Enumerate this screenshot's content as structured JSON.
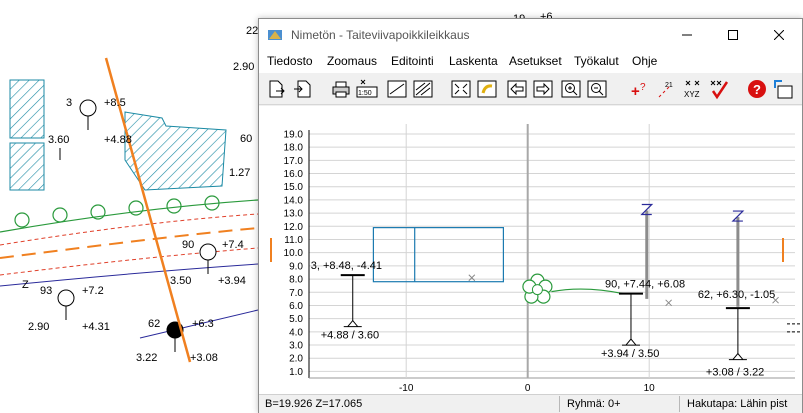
{
  "window": {
    "title": "Nimetön - Taiteviivapoikkileikkaus"
  },
  "menu": [
    "Tiedosto",
    "Zoomaus",
    "Editointi",
    "Laskenta",
    "Asetukset",
    "Työkalut",
    "Ohje"
  ],
  "toolbar": {
    "icons": [
      "new-file-icon",
      "open-file-icon",
      "print-icon",
      "scale-icon",
      "print-preview-icon",
      "hatch-icon",
      "zoom-extents-icon",
      "pan-icon",
      "previous-icon",
      "next-icon",
      "zoom-in-icon",
      "zoom-out-icon",
      "add-point-icon",
      "renumber-icon",
      "xyz-icon",
      "check-icon",
      "help-icon",
      "export-icon"
    ],
    "scale_label": "1:50",
    "number_label": "21"
  },
  "statusbar": {
    "coords": "B=19.926  Z=17.065",
    "group": "Ryhmä: 0+",
    "search": "Hakutapa: Lähin pist"
  },
  "background_map": {
    "labels": [
      "22",
      "19",
      "+6",
      "2.90",
      "3",
      "+8.5",
      "3.60",
      "+4.88",
      "60",
      "1.27",
      "90",
      "+7.4",
      "3.50",
      "+3.94",
      "93",
      "+7.2",
      "2.90",
      "+4.31",
      "62",
      "+6.3",
      "3.22",
      "+3.08",
      "Z"
    ]
  },
  "chart_data": {
    "type": "scatter",
    "title": "",
    "xlabel": "",
    "ylabel": "",
    "xlim": [
      -18,
      22
    ],
    "ylim": [
      0.5,
      19.3
    ],
    "x_ticks": [
      -10,
      0,
      10
    ],
    "y_ticks": [
      1.0,
      2.0,
      3.0,
      4.0,
      5.0,
      6.0,
      7.0,
      8.0,
      9.0,
      10.0,
      11.0,
      12.0,
      13.0,
      14.0,
      15.0,
      16.0,
      17.0,
      18.0,
      19.0
    ],
    "grid": true,
    "points": [
      {
        "x": -14.4,
        "y": 8.3,
        "label": "3, +8.48, -4.41",
        "sub_label": "+4.88 / 3.60"
      },
      {
        "x": 8.5,
        "y": 6.9,
        "label": "90, +7.44, +6.08",
        "sub_label": "+3.94 / 3.50"
      },
      {
        "x": 17.3,
        "y": 5.8,
        "label": "62, +6.30, -1.05",
        "sub_label": "+3.08 / 3.22"
      }
    ],
    "building_box": {
      "x0": -12.7,
      "x1": -2.0,
      "y0": 7.8,
      "y1": 11.9,
      "divider_x": -9.3
    },
    "tree": {
      "x": 0.8,
      "y": 7.2
    }
  }
}
